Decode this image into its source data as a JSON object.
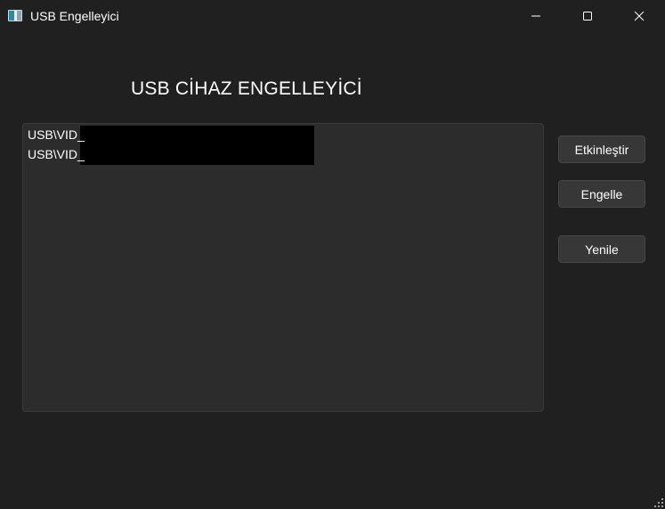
{
  "window": {
    "title": "USB Engelleyici",
    "icon": "app-window-icon",
    "controls": [
      "minimize-icon",
      "maximize-icon",
      "close-icon"
    ]
  },
  "main": {
    "heading": "USB CİHAZ ENGELLEYİCİ",
    "devices": [
      {
        "label": "USB\\VID_",
        "redacted": true
      },
      {
        "label": "USB\\VID_",
        "redacted": true
      }
    ]
  },
  "buttons": {
    "enable": "Etkinleştir",
    "block": "Engelle",
    "refresh": "Yenile"
  },
  "colors": {
    "background": "#202020",
    "list_background": "#2c2c2c",
    "button_background": "#373737",
    "text": "#ffffff"
  }
}
